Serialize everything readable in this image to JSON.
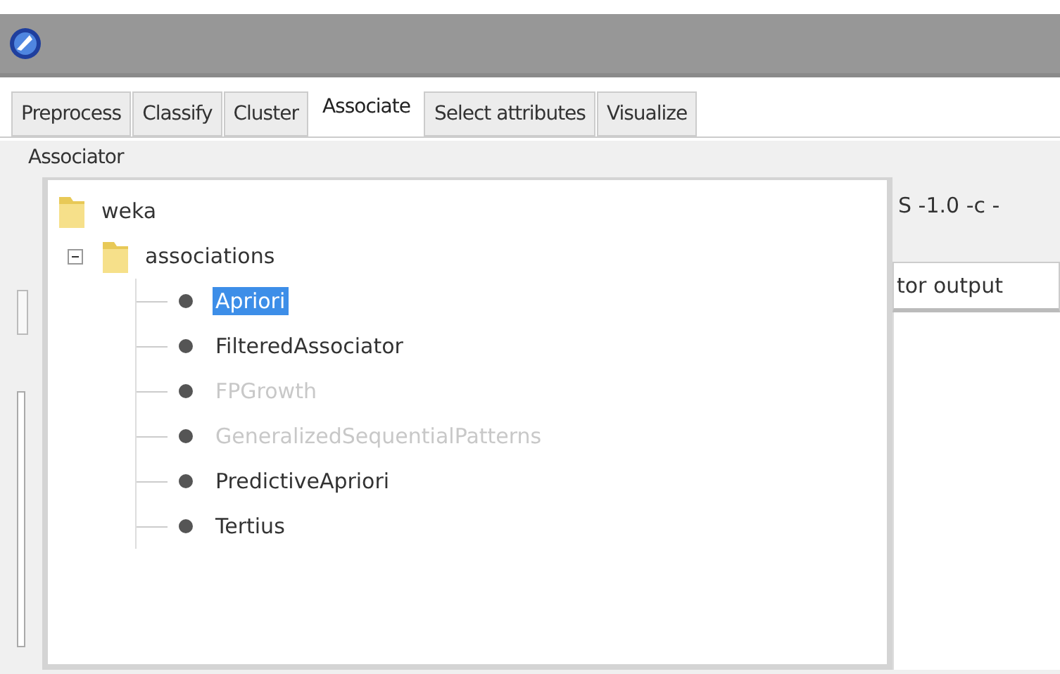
{
  "tabs": [
    {
      "label": "Preprocess",
      "selected": false
    },
    {
      "label": "Classify",
      "selected": false
    },
    {
      "label": "Cluster",
      "selected": false
    },
    {
      "label": "Associate",
      "selected": true
    },
    {
      "label": "Select attributes",
      "selected": false
    },
    {
      "label": "Visualize",
      "selected": false
    }
  ],
  "panel": {
    "title": "Associator",
    "options_text": "S -1.0 -c -",
    "output_tab": "tor output"
  },
  "tree": [
    {
      "label": "weka",
      "children": [
        {
          "label": "associations",
          "expanded": true,
          "children": [
            {
              "label": "Apriori",
              "selected": true,
              "disabled": false
            },
            {
              "label": "FilteredAssociator",
              "selected": false,
              "disabled": false
            },
            {
              "label": "FPGrowth",
              "selected": false,
              "disabled": true
            },
            {
              "label": "GeneralizedSequentialPatterns",
              "selected": false,
              "disabled": true
            },
            {
              "label": "PredictiveApriori",
              "selected": false,
              "disabled": false
            },
            {
              "label": "Tertius",
              "selected": false,
              "disabled": false
            }
          ]
        }
      ]
    }
  ]
}
